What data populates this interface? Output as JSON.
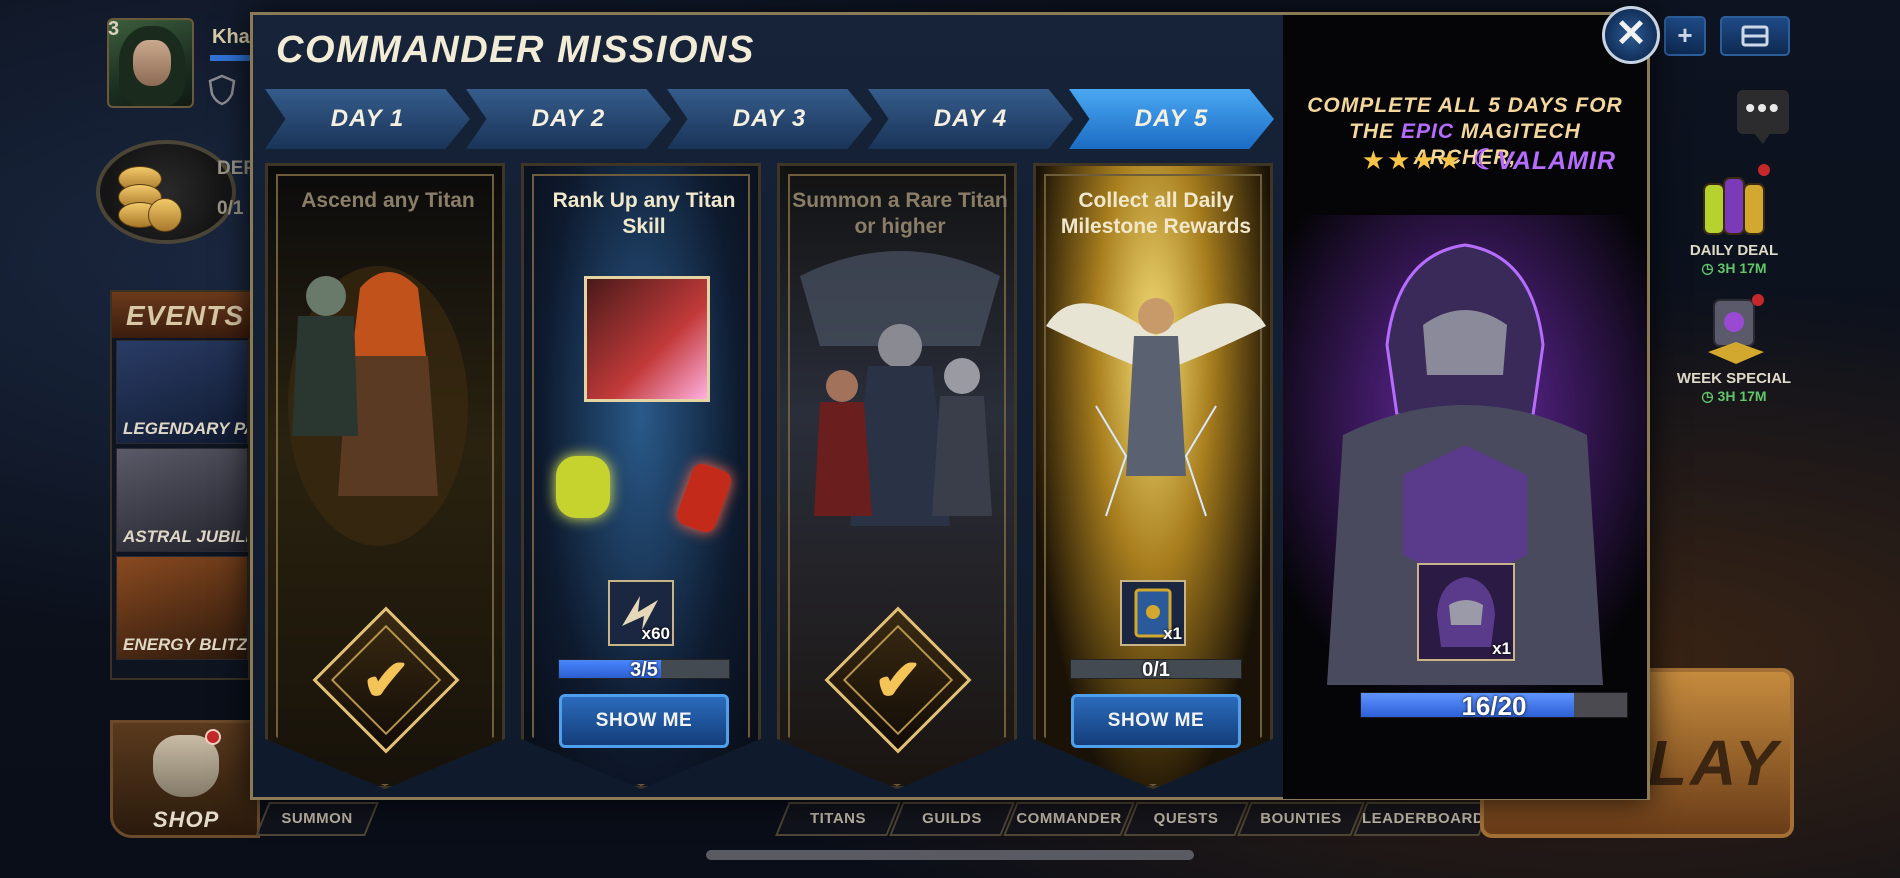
{
  "player": {
    "level": "3",
    "name": "Kha",
    "defense_label": "DEF",
    "defense_value": "0/1"
  },
  "events": {
    "title": "EVENTS",
    "items": [
      {
        "label": "LEGENDARY PA"
      },
      {
        "label": "ASTRAL JUBILE"
      },
      {
        "label": "ENERGY BLITZ"
      }
    ]
  },
  "shop": {
    "label": "SHOP"
  },
  "bottom_nav": [
    {
      "label": "SUMMON"
    },
    {
      "label": "TITANS"
    },
    {
      "label": "GUILDS"
    },
    {
      "label": "COMMANDER"
    },
    {
      "label": "QUESTS"
    },
    {
      "label": "BOUNTIES"
    },
    {
      "label": "LEADERBOARD"
    }
  ],
  "play": {
    "label": "LAY"
  },
  "right_panel": {
    "daily_deal": {
      "label": "DAILY DEAL",
      "timer": "3H 17M"
    },
    "week_special": {
      "label": "WEEK SPECIAL",
      "timer": "3H 17M"
    }
  },
  "top_buttons": {
    "plus": "+"
  },
  "chat": {
    "dots": "•••"
  },
  "modal": {
    "title": "COMMANDER MISSIONS",
    "close": "✕",
    "tabs": [
      {
        "label": "DAY 1"
      },
      {
        "label": "DAY 2"
      },
      {
        "label": "DAY 3"
      },
      {
        "label": "DAY 4"
      },
      {
        "label": "DAY 5"
      }
    ],
    "active_tab": "DAY 5",
    "missions": [
      {
        "title": "Ascend any Titan",
        "status": "completed",
        "check": "✔"
      },
      {
        "title": "Rank Up any Titan Skill",
        "status": "in_progress",
        "reward_qty": "x60",
        "progress_text": "3/5",
        "progress": 0.6,
        "button": "SHOW ME"
      },
      {
        "title": "Summon a Rare Titan or higher",
        "status": "completed",
        "check": "✔"
      },
      {
        "title": "Collect all Daily Milestone Rewards",
        "status": "in_progress",
        "reward_qty": "x1",
        "progress_text": "0/1",
        "progress": 0,
        "button": "SHOW ME"
      }
    ],
    "final_reward": {
      "title_line1": "COMPLETE ALL 5 DAYS FOR",
      "title_the": "THE ",
      "title_epic": "EPIC",
      "title_line2_rest": " MAGITECH",
      "title_line3": "ARCHER,",
      "stars": "★★★★",
      "moon": "☾",
      "hero": "VALAMIR",
      "reward_qty": "x1",
      "progress_text": "16/20",
      "progress": 0.8
    }
  },
  "colors": {
    "accent_blue": "#2b6bbd",
    "gold": "#e2c077",
    "epic_purple": "#b66cff",
    "timer_green": "#62c66a"
  },
  "icons": {
    "close": "close-icon",
    "plus": "plus-icon",
    "inbox": "inbox-icon",
    "chat": "chat-bubble-icon",
    "check": "checkmark-icon",
    "clock": "clock-icon"
  }
}
